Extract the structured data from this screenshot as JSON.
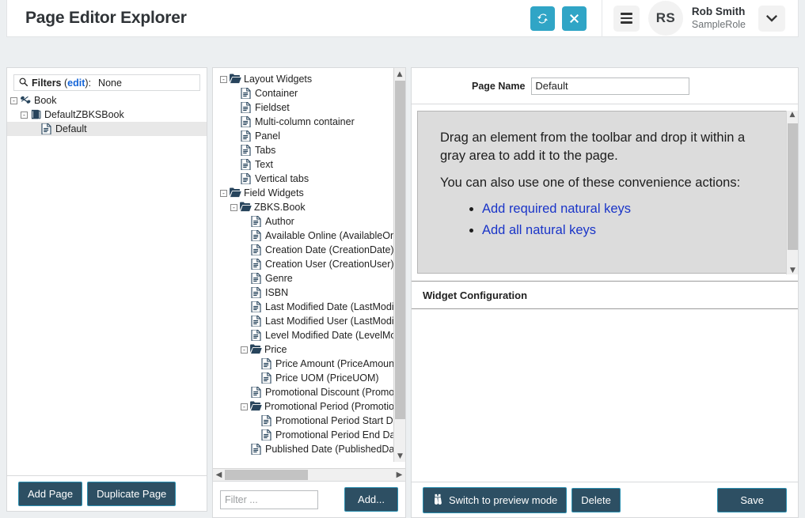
{
  "header": {
    "title": "Page Editor Explorer",
    "refresh_icon": "refresh-icon",
    "close_icon": "close-icon",
    "menu_icon": "hamburger-icon",
    "avatar_initials": "RS",
    "user_name": "Rob Smith",
    "user_role": "SampleRole",
    "caret_icon": "chevron-down-icon",
    "accent_color": "#30a5c6"
  },
  "left_panel": {
    "filters": {
      "search_icon": "search-icon",
      "label": "Filters",
      "edit_link": "edit",
      "colon": ":",
      "value": "None"
    },
    "tree": [
      {
        "label": "Book",
        "icon": "book-collection-icon",
        "depth": 0,
        "toggle": "-",
        "selected": false
      },
      {
        "label": "DefaultZBKSBook",
        "icon": "book-icon",
        "depth": 1,
        "toggle": "-",
        "selected": false
      },
      {
        "label": "Default",
        "icon": "page-icon",
        "depth": 2,
        "toggle": "",
        "selected": true
      }
    ],
    "buttons": [
      {
        "label": "Add Page",
        "name": "add-page-button"
      },
      {
        "label": "Duplicate Page",
        "name": "duplicate-page-button"
      }
    ]
  },
  "mid_panel": {
    "tree": [
      {
        "label": "Layout Widgets",
        "icon": "folder-open-icon",
        "depth": 0,
        "toggle": "-"
      },
      {
        "label": "Container",
        "icon": "page-icon",
        "depth": 1,
        "toggle": ""
      },
      {
        "label": "Fieldset",
        "icon": "page-icon",
        "depth": 1,
        "toggle": ""
      },
      {
        "label": "Multi-column container",
        "icon": "page-icon",
        "depth": 1,
        "toggle": ""
      },
      {
        "label": "Panel",
        "icon": "page-icon",
        "depth": 1,
        "toggle": ""
      },
      {
        "label": "Tabs",
        "icon": "page-icon",
        "depth": 1,
        "toggle": ""
      },
      {
        "label": "Text",
        "icon": "page-icon",
        "depth": 1,
        "toggle": ""
      },
      {
        "label": "Vertical tabs",
        "icon": "page-icon",
        "depth": 1,
        "toggle": ""
      },
      {
        "label": "Field Widgets",
        "icon": "folder-open-icon",
        "depth": 0,
        "toggle": "-"
      },
      {
        "label": "ZBKS.Book",
        "icon": "folder-open-icon",
        "depth": 1,
        "toggle": "-"
      },
      {
        "label": "Author",
        "icon": "page-icon",
        "depth": 2,
        "toggle": ""
      },
      {
        "label": "Available Online (AvailableOnline)",
        "icon": "page-icon",
        "depth": 2,
        "toggle": ""
      },
      {
        "label": "Creation Date (CreationDate)",
        "icon": "page-icon",
        "depth": 2,
        "toggle": ""
      },
      {
        "label": "Creation User (CreationUser)",
        "icon": "page-icon",
        "depth": 2,
        "toggle": ""
      },
      {
        "label": "Genre",
        "icon": "page-icon",
        "depth": 2,
        "toggle": ""
      },
      {
        "label": "ISBN",
        "icon": "page-icon",
        "depth": 2,
        "toggle": ""
      },
      {
        "label": "Last Modified Date (LastModifiedDate)",
        "icon": "page-icon",
        "depth": 2,
        "toggle": ""
      },
      {
        "label": "Last Modified User (LastModifiedUser)",
        "icon": "page-icon",
        "depth": 2,
        "toggle": ""
      },
      {
        "label": "Level Modified Date (LevelModifiedDate)",
        "icon": "page-icon",
        "depth": 2,
        "toggle": ""
      },
      {
        "label": "Price",
        "icon": "folder-open-icon",
        "depth": 2,
        "toggle": "-"
      },
      {
        "label": "Price Amount (PriceAmount)",
        "icon": "page-icon",
        "depth": 3,
        "toggle": ""
      },
      {
        "label": "Price UOM (PriceUOM)",
        "icon": "page-icon",
        "depth": 3,
        "toggle": ""
      },
      {
        "label": "Promotional Discount (PromotionalDiscount)",
        "icon": "page-icon",
        "depth": 2,
        "toggle": ""
      },
      {
        "label": "Promotional Period (PromotionalPeriod)",
        "icon": "folder-open-icon",
        "depth": 2,
        "toggle": "-"
      },
      {
        "label": "Promotional Period Start Date",
        "icon": "page-icon",
        "depth": 3,
        "toggle": ""
      },
      {
        "label": "Promotional Period End Date",
        "icon": "page-icon",
        "depth": 3,
        "toggle": ""
      },
      {
        "label": "Published Date (PublishedDate)",
        "icon": "page-icon",
        "depth": 2,
        "toggle": ""
      }
    ],
    "filter_placeholder": "Filter ...",
    "add_button": "Add...",
    "scroll_up_icon": "chevron-up-icon",
    "scroll_down_icon": "chevron-down-icon",
    "scroll_left_icon": "chevron-left-icon",
    "scroll_right_icon": "chevron-right-icon"
  },
  "right_panel": {
    "page_name_label": "Page Name",
    "page_name_value": "Default",
    "canvas": {
      "instruction": "Drag an element from the toolbar and drop it within a gray area to add it to the page.",
      "convenience_intro": "You can also use one of these convenience actions:",
      "links": [
        "Add required natural keys",
        "Add all natural keys"
      ],
      "link_color": "#1a35c8"
    },
    "widget_configuration_title": "Widget Configuration",
    "buttons": {
      "preview": "Switch to preview mode",
      "preview_icon": "binoculars-icon",
      "delete": "Delete",
      "save": "Save"
    },
    "scroll_up_icon": "chevron-up-icon",
    "scroll_down_icon": "chevron-down-icon"
  }
}
